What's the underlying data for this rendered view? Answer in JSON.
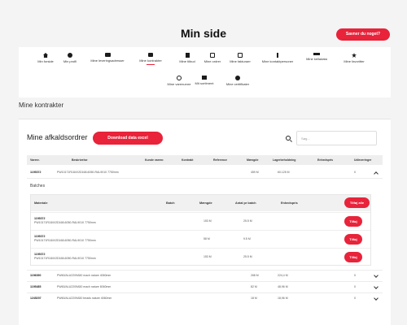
{
  "header": {
    "title": "Min side",
    "help_label": "Savner du noget?"
  },
  "nav": {
    "items": [
      {
        "label": "Min forside",
        "icon": "home-icon"
      },
      {
        "label": "Min profil",
        "icon": "user-icon"
      },
      {
        "label": "Mine leveringsadresser",
        "icon": "truck-icon"
      },
      {
        "label": "Mine kontrakter",
        "icon": "folder-icon",
        "active": true
      },
      {
        "label": "Mine tilbud",
        "icon": "document-icon"
      },
      {
        "label": "Mine ordrer",
        "icon": "calendar-icon"
      },
      {
        "label": "Mine fakturaer",
        "icon": "invoice-icon"
      },
      {
        "label": "Mine kontaktpersoner",
        "icon": "contact-icon"
      },
      {
        "label": "Mine kelladata",
        "icon": "data-icon"
      },
      {
        "label": "Mine favoritter",
        "icon": "star-icon"
      },
      {
        "label": "Mine varenumre",
        "icon": "link-icon"
      },
      {
        "label": "Mit sortiment",
        "icon": "list-icon"
      },
      {
        "label": "Mine certifikater",
        "icon": "certificate-icon"
      }
    ]
  },
  "section": {
    "title": "Mine kontrakter"
  },
  "card": {
    "title": "Mine afkaldsordrer",
    "download_label": "Download data excel",
    "search_placeholder": "Søg..."
  },
  "table": {
    "headers": [
      "Varenr.",
      "Beskrivelse",
      "Kunde varenr.",
      "Kontrakt",
      "Reference",
      "Mængde",
      "Lagerbeholdning",
      "Enhedspris",
      "Udleveringer"
    ],
    "rows": [
      {
        "varenr": "1195372",
        "beskrivelse": "PW10171R184V2D168-6050-RAL9010 7750mm",
        "maengde": "459 M",
        "lager": "60.125 M",
        "enhedspris": "",
        "udleveringer": "0",
        "expanded": true
      },
      {
        "varenr": "1196390",
        "beskrivelse": "PW60/ALU2209A50 mach nature 4060mm",
        "maengde": "268 M",
        "lager": "224,4 M",
        "enhedspris": "",
        "udleveringer": "0",
        "expanded": false
      },
      {
        "varenr": "1195485",
        "beskrivelse": "PW60/ALU2209A50 mach nature 6060mm",
        "maengde": "82 M",
        "lager": "48,96 M",
        "enhedspris": "",
        "udleveringer": "0",
        "expanded": false
      },
      {
        "varenr": "1245207",
        "beskrivelse": "PW60/ALU2209A50 beads nature 4060mm",
        "maengde": "18 M",
        "lager": "18,96 M",
        "enhedspris": "",
        "udleveringer": "0",
        "expanded": false
      }
    ]
  },
  "batches": {
    "label": "Batches",
    "headers": [
      "Materiale",
      "Batch",
      "Mængde",
      "Antal pr batch",
      "Enhedspris"
    ],
    "add_all_label": "Tilføj alle",
    "add_label": "Tilføj",
    "rows": [
      {
        "id": "1195372",
        "desc": "PW10171R184V2D168-6050-RAL9010 7750mm",
        "maengde": "153 M",
        "antal": "25.5 M"
      },
      {
        "id": "1195372",
        "desc": "PW10171R184V2D168-6050-RAL9010 7750mm",
        "maengde": "58 M",
        "antal": "9.5 M"
      },
      {
        "id": "1195372",
        "desc": "PW10171R184V2D168-6050-RAL9010 7750mm",
        "maengde": "153 M",
        "antal": "25.5 M"
      }
    ]
  },
  "colors": {
    "accent": "#e8233a",
    "background": "#f4f4f4",
    "card": "#ffffff"
  }
}
